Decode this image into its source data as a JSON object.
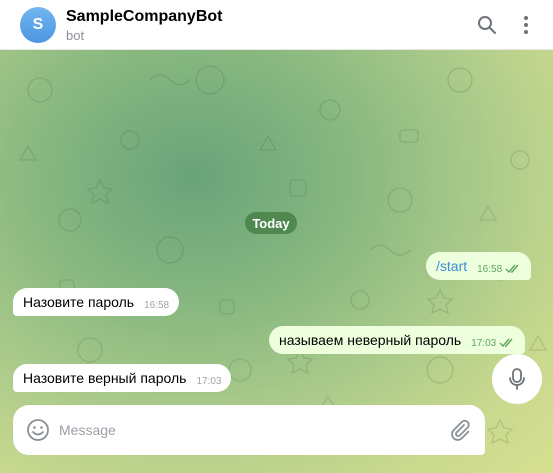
{
  "header": {
    "avatar_letter": "S",
    "title": "SampleCompanyBot",
    "subtitle": "bot",
    "accent_color": "#4c95e0"
  },
  "chat": {
    "date_divider": "Today",
    "messages": [
      {
        "direction": "out",
        "text": "/start",
        "time": "16:58",
        "status": "read"
      },
      {
        "direction": "in",
        "text": "Назовите пароль",
        "time": "16:58"
      },
      {
        "direction": "out",
        "text": "называем неверный пароль",
        "time": "17:03",
        "status": "read"
      },
      {
        "direction": "in",
        "text": "Назовите верный пароль",
        "time": "17:03"
      }
    ]
  },
  "composer": {
    "placeholder": "Message",
    "icons": [
      "emoji-icon",
      "paperclip-icon",
      "microphone-icon"
    ]
  }
}
